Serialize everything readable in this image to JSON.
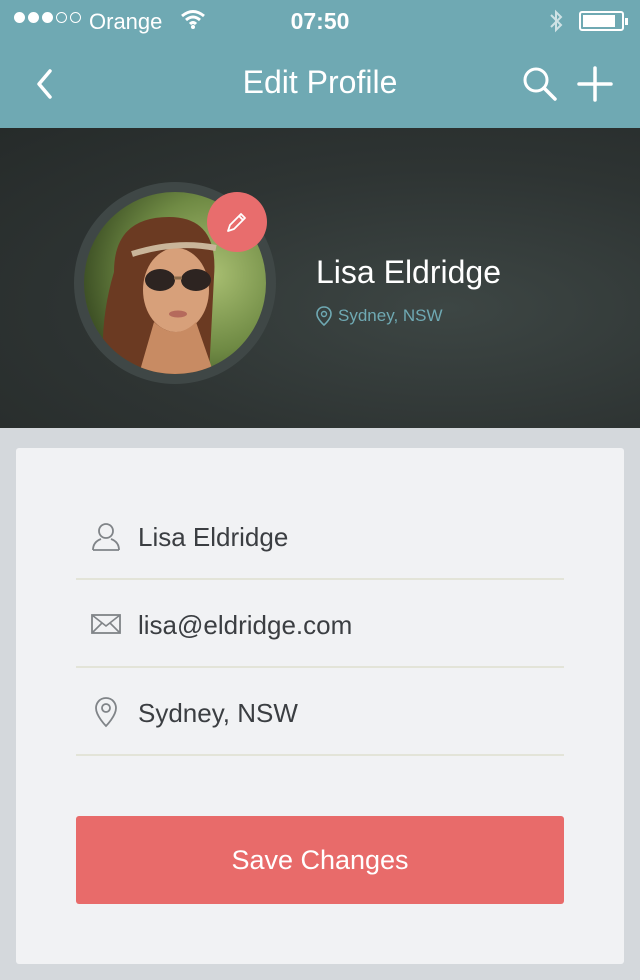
{
  "status_bar": {
    "carrier": "Orange",
    "time": "07:50",
    "signal_bars_filled": 3,
    "signal_bars_total": 5
  },
  "nav": {
    "title": "Edit Profile",
    "icons": [
      "back-chevron-icon",
      "search-icon",
      "plus-icon"
    ]
  },
  "profile": {
    "name": "Lisa Eldridge",
    "location": "Sydney, NSW",
    "avatar_icon": "avatar-photo",
    "edit_icon": "pencil-icon"
  },
  "form": {
    "fields": [
      {
        "icon": "user-icon",
        "value": "Lisa Eldridge"
      },
      {
        "icon": "mail-icon",
        "value": "lisa@eldridge.com"
      },
      {
        "icon": "location-pin-icon",
        "value": "Sydney, NSW"
      }
    ],
    "save_label": "Save Changes"
  },
  "colors": {
    "nav_bg": "#6fa9b3",
    "accent": "#e86b6a",
    "hero_bg": "#2e3433",
    "page_bg": "#d4d8dc",
    "card_bg": "#f1f2f4"
  }
}
